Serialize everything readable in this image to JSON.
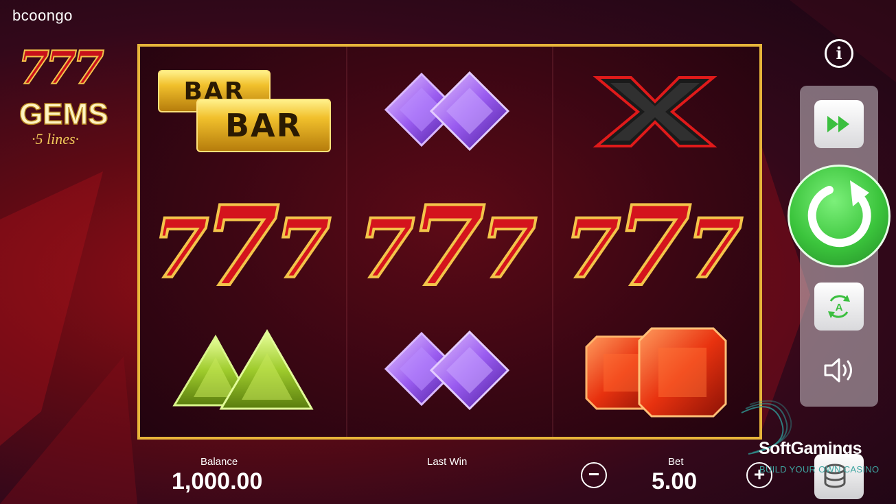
{
  "brand": {
    "name": "bcoongo"
  },
  "logo": {
    "line1": "777",
    "line2": "GEMS",
    "line3": "·5 lines·"
  },
  "reels": [
    {
      "top": "bar-bar",
      "middle": "777",
      "bottom": "green-gem"
    },
    {
      "top": "purple-gem",
      "middle": "777",
      "bottom": "purple-gem"
    },
    {
      "top": "black-x",
      "middle": "777",
      "bottom": "red-gem"
    }
  ],
  "bar_symbol": {
    "label_top": "BAR",
    "label_bottom": "BAR"
  },
  "seven_symbol": {
    "text": "777"
  },
  "controls": {
    "info_icon": "i",
    "fast_play_icon": "fast-forward-icon",
    "spin_icon": "spin-icon",
    "autoplay_icon": "A",
    "sound_icon": "speaker-icon",
    "coins_icon": "coins-icon"
  },
  "footer": {
    "balance_label": "Balance",
    "balance_value": "1,000.00",
    "last_win_label": "Last Win",
    "bet_label": "Bet",
    "bet_value": "5.00",
    "minus_icon": "−",
    "plus_icon": "+"
  },
  "watermark": {
    "title": "SoftGamings",
    "subtitle": "BUILD YOUR OWN CASINO"
  },
  "colors": {
    "frame": "#e7b53a",
    "spin": "#3bc43c",
    "background": "#5e0a14"
  }
}
